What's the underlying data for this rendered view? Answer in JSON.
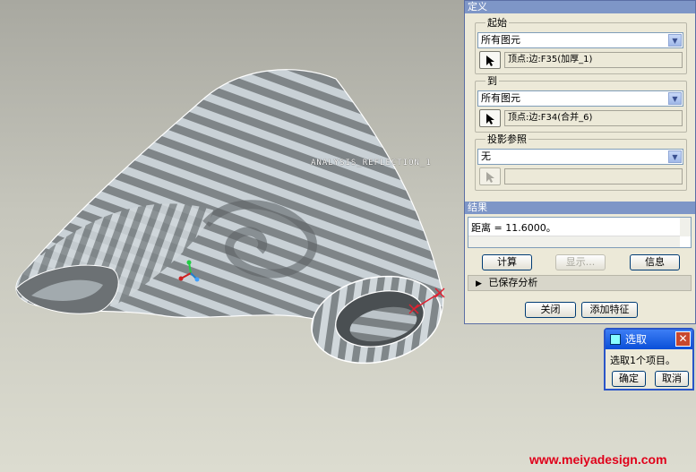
{
  "viewport": {
    "model_label": "ANALYSIS_REFLECTION_1",
    "watermark": "www.meiyadesign.com"
  },
  "dialog": {
    "definition_header": "定义",
    "from": {
      "label": "起始",
      "filter_value": "所有图元",
      "selection": "顶点:边:F35(加厚_1)"
    },
    "to": {
      "label": "到",
      "filter_value": "所有图元",
      "selection": "顶点:边:F34(合并_6)"
    },
    "projection": {
      "label": "投影参照",
      "filter_value": "无",
      "selection": ""
    },
    "result_header": "结果",
    "result_text": "距离 = 11.6000。",
    "buttons": {
      "compute": "计算",
      "display": "显示...",
      "info": "信息",
      "close": "关闭",
      "add_feature": "添加特征"
    },
    "saved_analysis_label": "已保存分析"
  },
  "select_popup": {
    "title": "选取",
    "message": "选取1个项目。",
    "ok": "确定",
    "cancel": "取消"
  },
  "colors": {
    "viewport_bg": "#c4c4ba",
    "dialog_bg": "#ece9d8",
    "section_header": "#7e96c7",
    "title_bar": "#0a4fd8",
    "close_button": "#c8482e",
    "watermark": "#e0001a"
  }
}
